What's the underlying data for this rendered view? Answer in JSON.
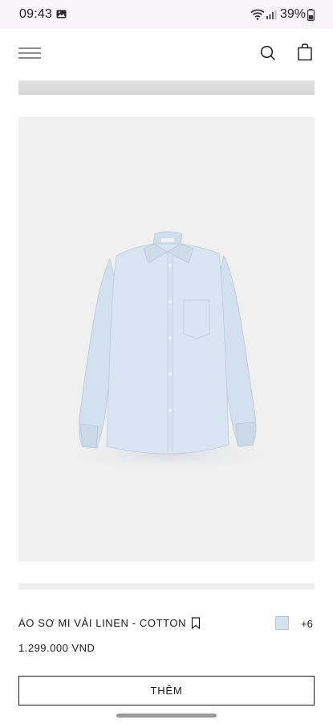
{
  "status_bar": {
    "time": "09:43",
    "battery": "39%",
    "icons": [
      "gallery-icon",
      "wifi-icon",
      "signal-icon",
      "battery-icon"
    ]
  },
  "header": {
    "icons": [
      "menu-icon",
      "search-icon",
      "shopping-bag-icon"
    ]
  },
  "product": {
    "name": "ÁO SƠ MI VẢI LINEN - COTTON",
    "price": "1.299.000 VND",
    "more_colors": "+6",
    "swatch_color": "#d5e2f0",
    "add_label": "THÊM"
  },
  "colors": {
    "image_background": "#f0f0f0",
    "shirt": "#d7e3f1"
  }
}
